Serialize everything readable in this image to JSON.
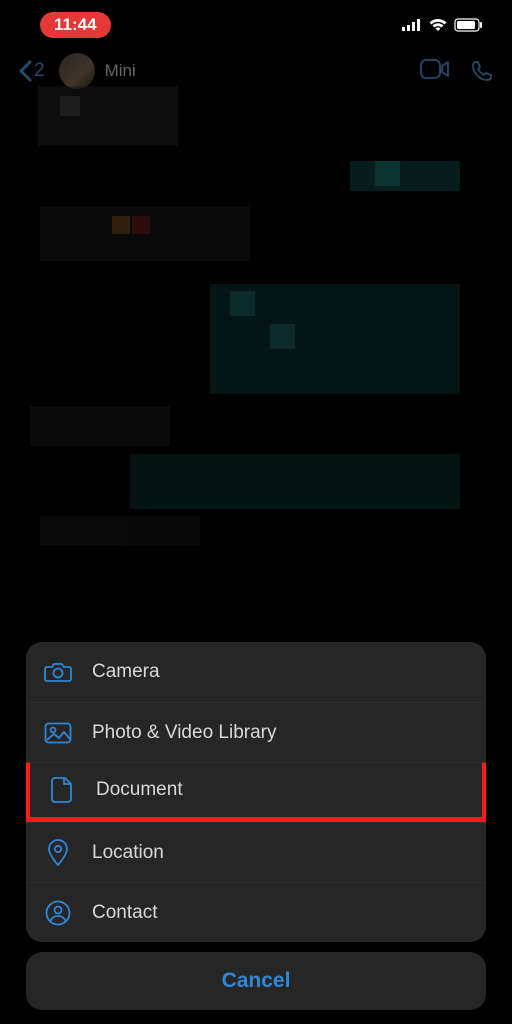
{
  "status": {
    "time": "11:44"
  },
  "nav": {
    "back_badge": "2",
    "contact_name": "Mini"
  },
  "sheet": {
    "items": [
      {
        "label": "Camera",
        "icon": "camera-icon",
        "highlighted": false
      },
      {
        "label": "Photo & Video Library",
        "icon": "photo-icon",
        "highlighted": false
      },
      {
        "label": "Document",
        "icon": "document-icon",
        "highlighted": true
      },
      {
        "label": "Location",
        "icon": "location-icon",
        "highlighted": false
      },
      {
        "label": "Contact",
        "icon": "contact-icon",
        "highlighted": false
      }
    ],
    "cancel": "Cancel"
  },
  "colors": {
    "accent": "#2f87d8",
    "highlight": "#ff1a1a"
  }
}
